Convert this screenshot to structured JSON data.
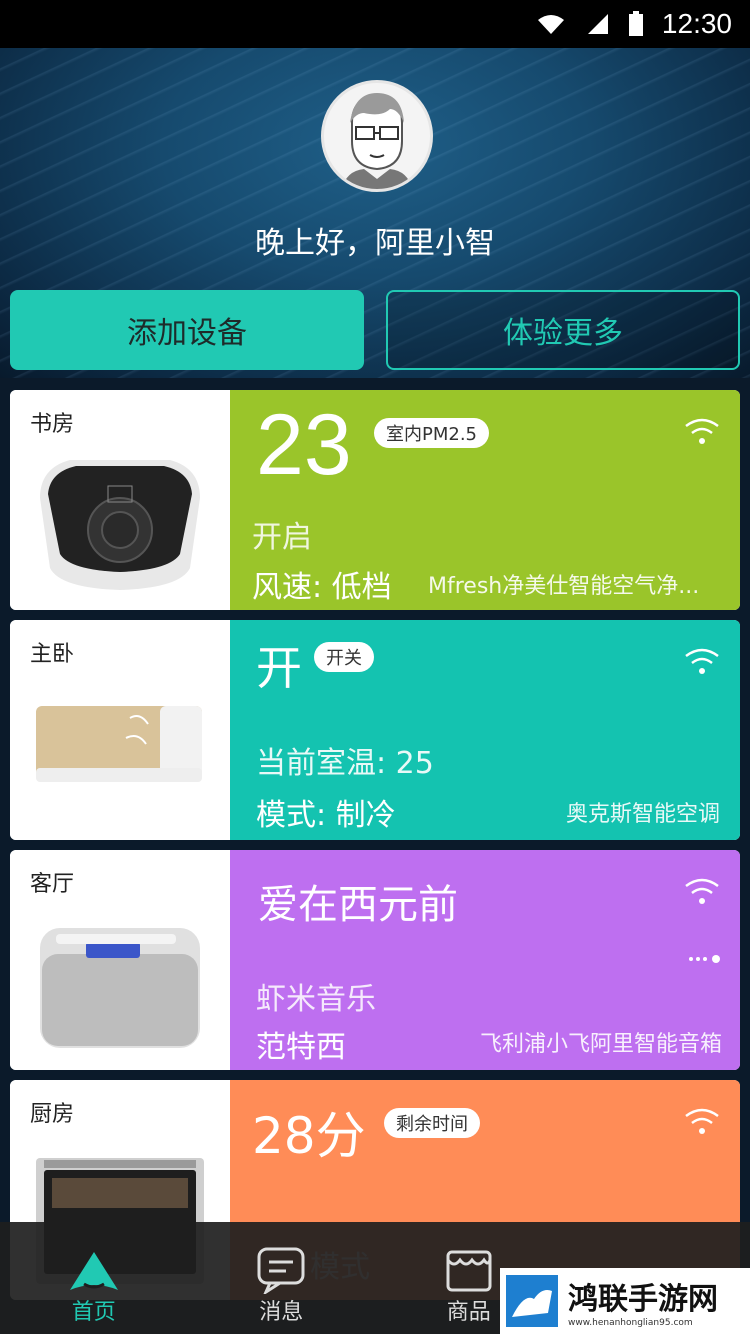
{
  "status": {
    "time": "12:30"
  },
  "user": {
    "greeting": "晚上好，阿里小智"
  },
  "actions": {
    "add_device": "添加设备",
    "experience_more": "体验更多"
  },
  "devices": [
    {
      "room": "书房",
      "value": "23",
      "badge": "室内PM2.5",
      "status": "开启",
      "mode": "风速: 低档",
      "name": "Mfresh净美仕智能空气净...",
      "color": "#9ac52a"
    },
    {
      "room": "主卧",
      "value": "开",
      "badge": "开关",
      "temp": "当前室温: 25",
      "mode": "模式: 制冷",
      "name": "奥克斯智能空调",
      "color": "#14c3b0"
    },
    {
      "room": "客厅",
      "value": "爱在西元前",
      "source": "虾米音乐",
      "artist": "范特西",
      "name": "飞利浦小飞阿里智能音箱",
      "color": "#be6ff0"
    },
    {
      "room": "厨房",
      "value": "28分",
      "badge": "剩余时间",
      "mode_partial": "模式",
      "color": "#ff8c57"
    }
  ],
  "nav": [
    {
      "label": "首页",
      "icon": "home-icon",
      "active": true
    },
    {
      "label": "消息",
      "icon": "message-icon",
      "active": false
    },
    {
      "label": "商品",
      "icon": "store-icon",
      "active": false
    },
    {
      "label": "",
      "icon": "settings-icon",
      "active": false
    }
  ],
  "watermark": {
    "title": "鸿联手游网",
    "subtitle": "www.henanhonglian95.com"
  }
}
